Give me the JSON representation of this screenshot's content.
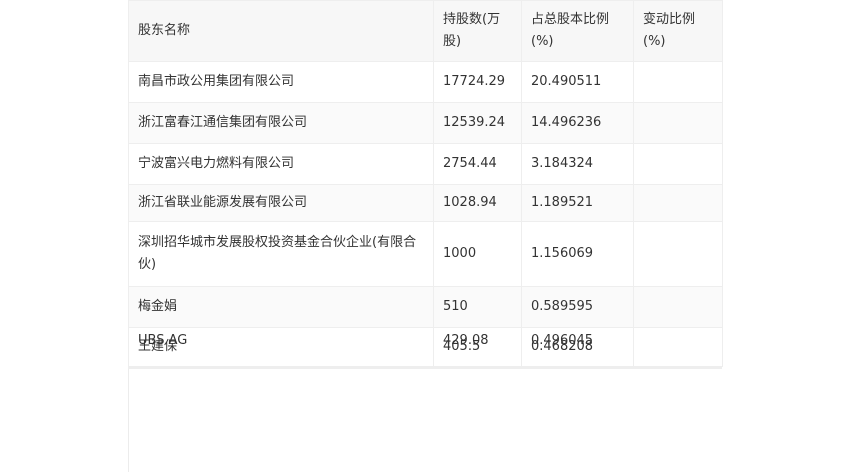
{
  "table": {
    "headers": [
      "股东名称",
      "持股数(万股)",
      "占总股本比例(%)",
      "变动比例(%)"
    ],
    "rows": [
      {
        "name": "南昌市政公用集团有限公司",
        "shares": "17724.29",
        "ratio": "20.490511",
        "change": ""
      },
      {
        "name": "浙江富春江通信集团有限公司",
        "shares": "12539.24",
        "ratio": "14.496236",
        "change": ""
      },
      {
        "name": "宁波富兴电力燃料有限公司",
        "shares": "2754.44",
        "ratio": "3.184324",
        "change": ""
      },
      {
        "name": "浙江省联业能源发展有限公司",
        "shares": "1028.94",
        "ratio": "1.189521",
        "change": ""
      },
      {
        "name": "深圳招华城市发展股权投资基金合伙企业(有限合伙)",
        "shares": "1000",
        "ratio": "1.156069",
        "change": ""
      },
      {
        "name": "梅金娟",
        "shares": "510",
        "ratio": "0.589595",
        "change": ""
      },
      {
        "name": "UBS AG",
        "shares": "429.08",
        "ratio": "0.496045",
        "change": ""
      },
      {
        "name": "王建保",
        "shares": "405.5",
        "ratio": "0.468208",
        "change": ""
      }
    ]
  }
}
